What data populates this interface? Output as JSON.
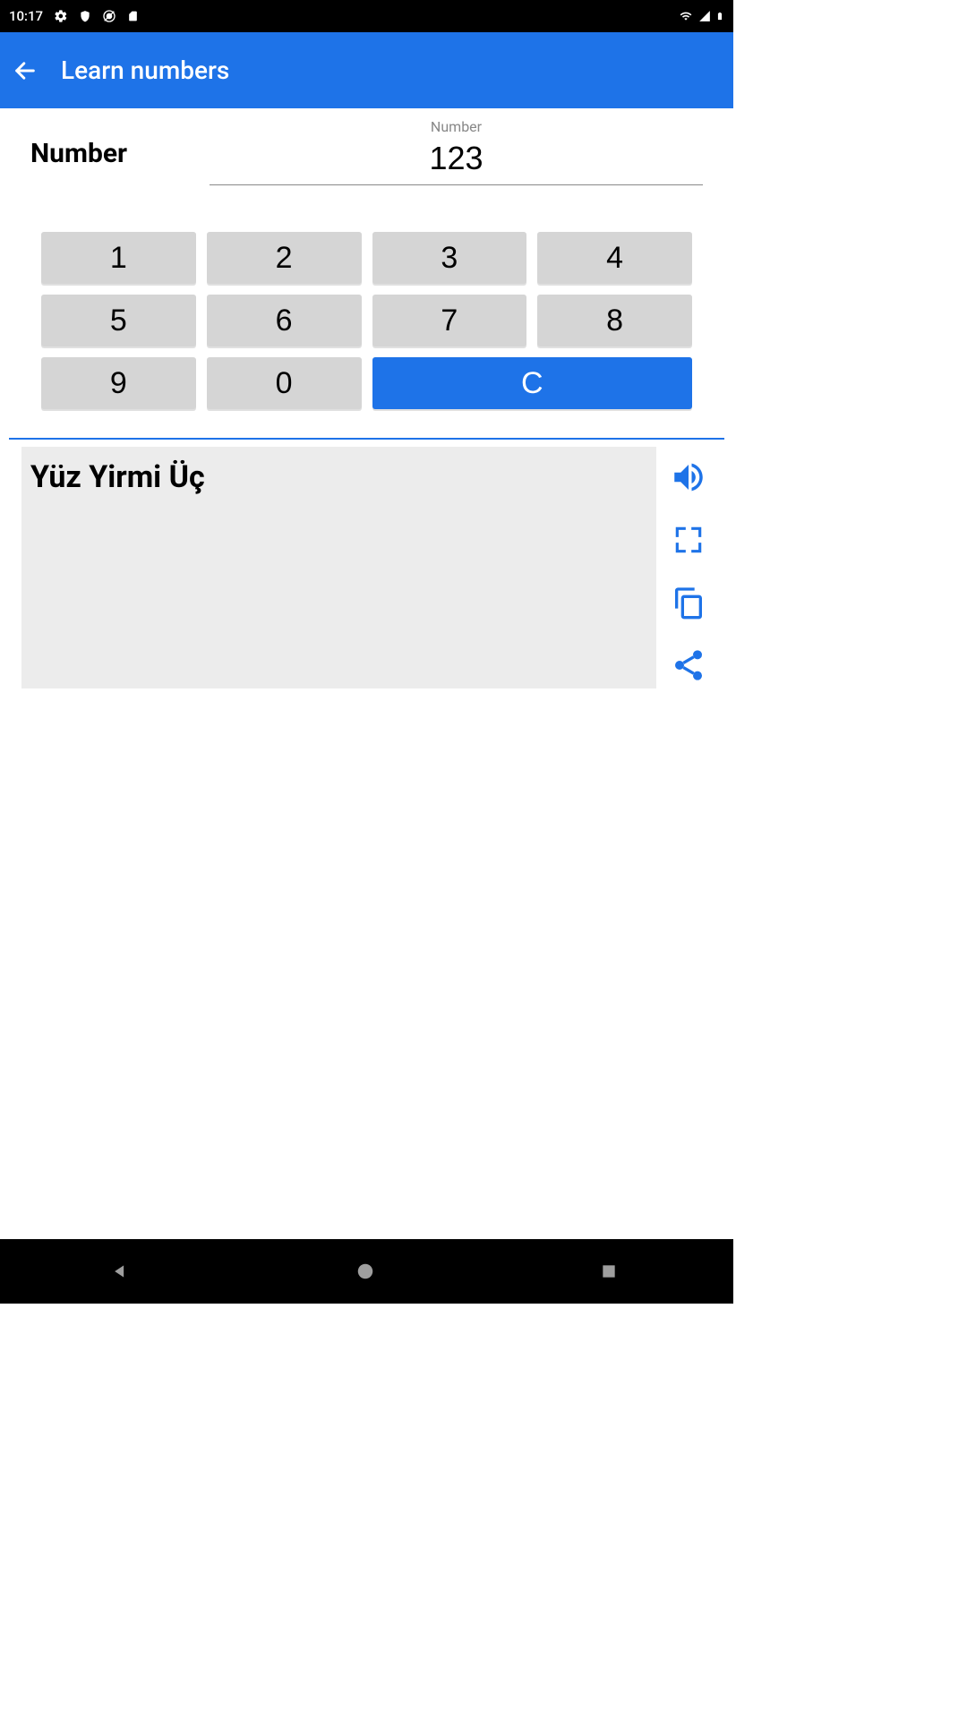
{
  "status": {
    "time": "10:17"
  },
  "appbar": {
    "title": "Learn numbers"
  },
  "input": {
    "label": "Number",
    "field_label": "Number",
    "value": "123"
  },
  "keypad": {
    "k1": "1",
    "k2": "2",
    "k3": "3",
    "k4": "4",
    "k5": "5",
    "k6": "6",
    "k7": "7",
    "k8": "8",
    "k9": "9",
    "k0": "0",
    "clear": "C"
  },
  "result": {
    "text": "Yüz Yirmi Üç"
  },
  "colors": {
    "accent": "#1e73e8"
  }
}
